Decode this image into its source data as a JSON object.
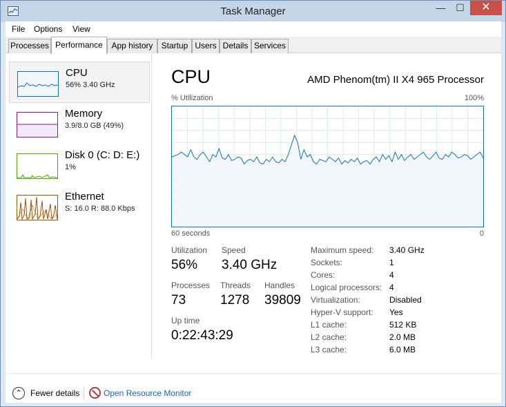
{
  "window": {
    "title": "Task Manager",
    "close_glyph": "✕",
    "min_glyph": "—",
    "max_glyph": "☐"
  },
  "menu": [
    "File",
    "Options",
    "View"
  ],
  "tabs": [
    "Processes",
    "Performance",
    "App history",
    "Startup",
    "Users",
    "Details",
    "Services"
  ],
  "active_tab": "Performance",
  "sidebar": [
    {
      "name": "CPU",
      "sub": "56%  3.40 GHz",
      "color": "#1172b1"
    },
    {
      "name": "Memory",
      "sub": "3.9/8.0 GB (49%)",
      "color": "#8b13a4"
    },
    {
      "name": "Disk 0 (C: D: E:)",
      "sub": "1%",
      "color": "#4da60c"
    },
    {
      "name": "Ethernet",
      "sub": "S: 16.0  R: 88.0 Kbps",
      "color": "#a74f01"
    }
  ],
  "main": {
    "title": "CPU",
    "processor": "AMD Phenom(tm) II X4 965 Processor",
    "graph_top_left": "% Utilization",
    "graph_top_right": "100%",
    "graph_bottom_left": "60 seconds",
    "graph_bottom_right": "0",
    "utilization_history": [
      58,
      59,
      60,
      62,
      60,
      58,
      64,
      58,
      56,
      60,
      62,
      58,
      54,
      60,
      58,
      65,
      57,
      56,
      60,
      55,
      56,
      58,
      57,
      52,
      55,
      56,
      54,
      58,
      53,
      52,
      56,
      54,
      58,
      54,
      53,
      56,
      54,
      60,
      68,
      76,
      70,
      56,
      64,
      58,
      60,
      54,
      52,
      56,
      55,
      54,
      58,
      56,
      54,
      57,
      52,
      55,
      53,
      56,
      54,
      57,
      52,
      54,
      55,
      52,
      56,
      58,
      54,
      60,
      56,
      59,
      54,
      62,
      56,
      60,
      55,
      58,
      60,
      56,
      58,
      60,
      62,
      58,
      56,
      59,
      62,
      57,
      56,
      60,
      58,
      62,
      60,
      57,
      58,
      60,
      59,
      56,
      58,
      60,
      62,
      57
    ]
  },
  "stats": {
    "utilization_label": "Utilization",
    "utilization_value": "56%",
    "speed_label": "Speed",
    "speed_value": "3.40 GHz",
    "processes_label": "Processes",
    "processes_value": "73",
    "threads_label": "Threads",
    "threads_value": "1278",
    "handles_label": "Handles",
    "handles_value": "39809",
    "uptime_label": "Up time",
    "uptime_value": "0:22:43:29"
  },
  "specs": [
    {
      "label": "Maximum speed:",
      "value": "3.40 GHz"
    },
    {
      "label": "Sockets:",
      "value": "1"
    },
    {
      "label": "Cores:",
      "value": "4"
    },
    {
      "label": "Logical processors:",
      "value": "4"
    },
    {
      "label": "Virtualization:",
      "value": "Disabled"
    },
    {
      "label": "Hyper-V support:",
      "value": "Yes"
    },
    {
      "label": "L1 cache:",
      "value": "512 KB"
    },
    {
      "label": "L2 cache:",
      "value": "2.0 MB"
    },
    {
      "label": "L3 cache:",
      "value": "6.0 MB"
    }
  ],
  "footer": {
    "fewer_details": "Fewer details",
    "open_monitor": "Open Resource Monitor",
    "fewer_glyph": "⌃"
  },
  "icons": {
    "fewer": "chevron-up-circle-icon",
    "resource_monitor": "resource-monitor-icon",
    "app": "task-manager-icon"
  }
}
